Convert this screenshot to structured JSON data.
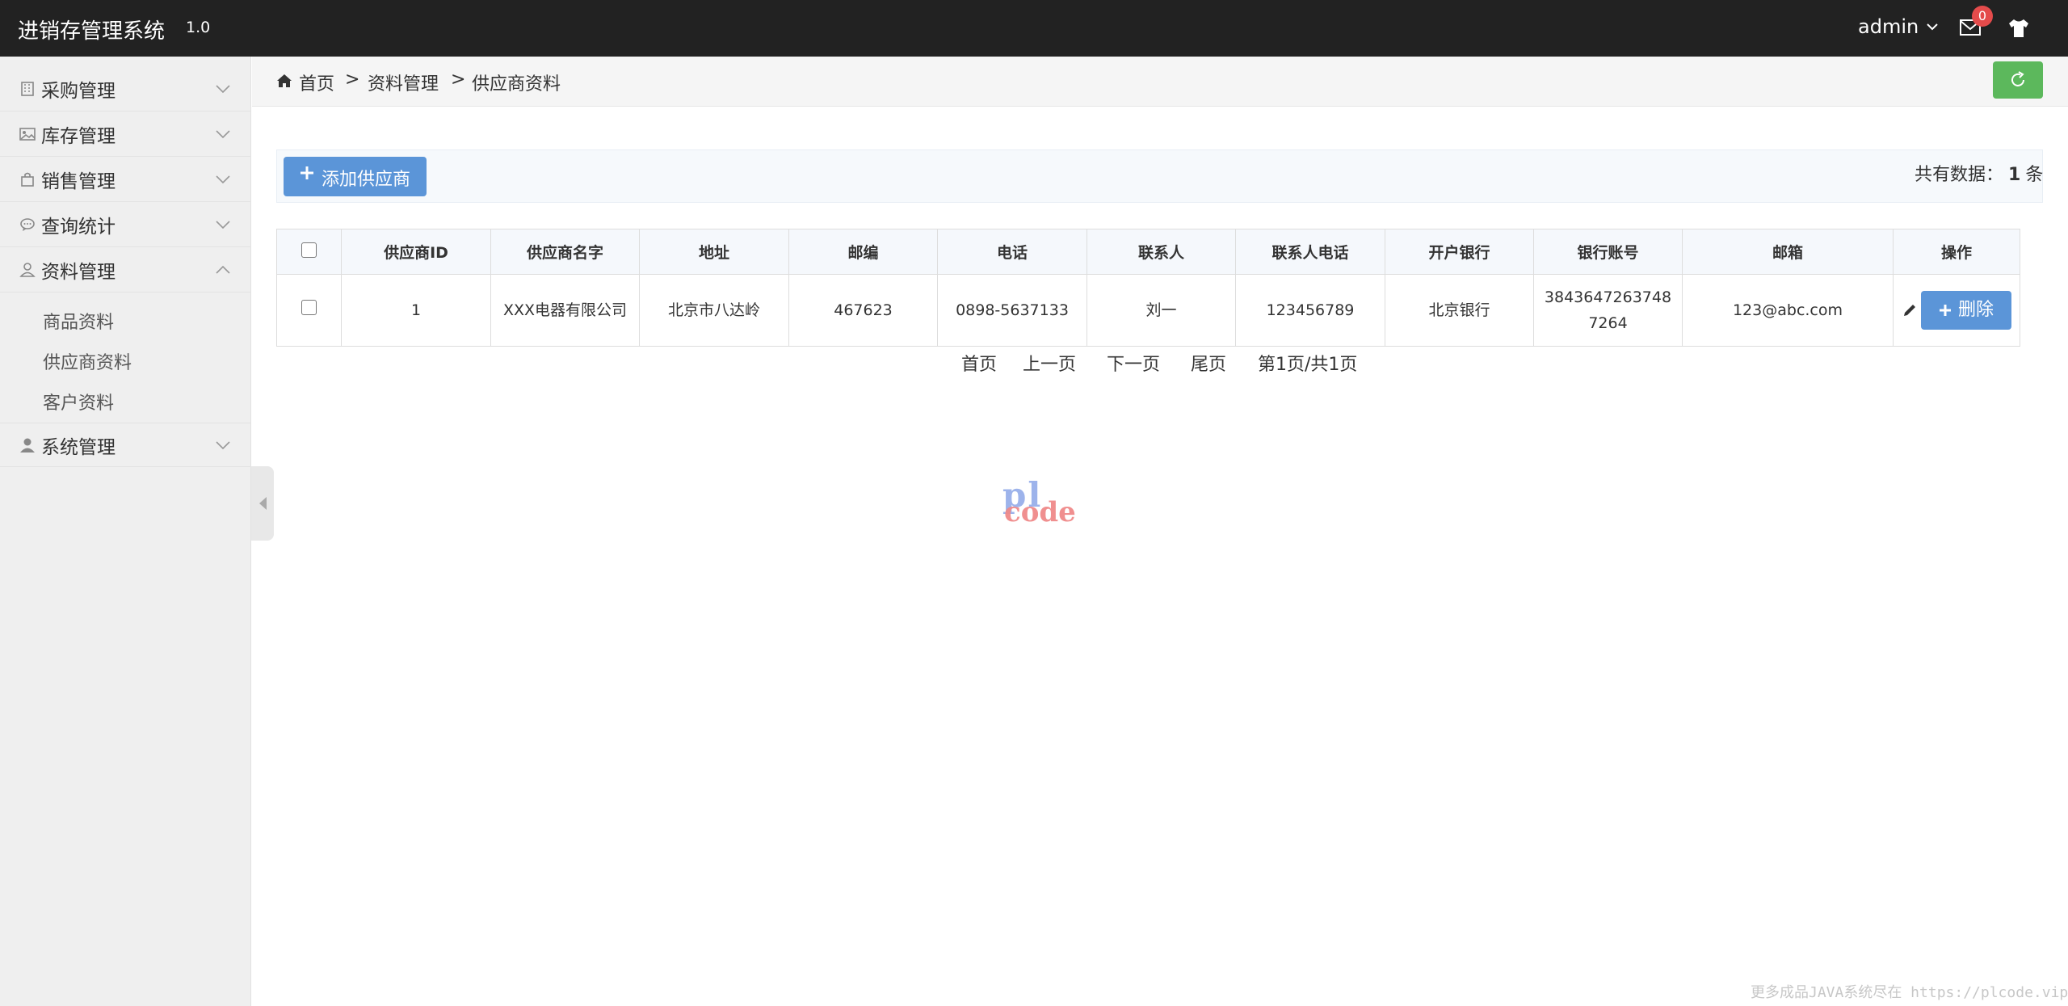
{
  "header": {
    "brand": "进销存管理系统",
    "version": "1.0",
    "user": "admin",
    "mail_count": "0"
  },
  "sidebar": {
    "items": [
      {
        "label": "采购管理",
        "icon": "building-icon"
      },
      {
        "label": "库存管理",
        "icon": "image-icon"
      },
      {
        "label": "销售管理",
        "icon": "shopping-bag-icon"
      },
      {
        "label": "查询统计",
        "icon": "comment-icon"
      },
      {
        "label": "资料管理",
        "icon": "user-outline-icon"
      },
      {
        "label": "系统管理",
        "icon": "user-icon"
      }
    ],
    "sub_items": [
      "商品资料",
      "供应商资料",
      "客户资料"
    ]
  },
  "breadcrumb": {
    "home": "首页",
    "sep": ">",
    "level2": "资料管理",
    "current": "供应商资料"
  },
  "toolbar": {
    "add_label": "添加供应商",
    "total_prefix": "共有数据：",
    "total_count": "1",
    "total_suffix": "条"
  },
  "table": {
    "columns": [
      "供应商ID",
      "供应商名字",
      "地址",
      "邮编",
      "电话",
      "联系人",
      "联系人电话",
      "开户银行",
      "银行账号",
      "邮箱",
      "操作"
    ],
    "rows": [
      {
        "id": "1",
        "name": "XXX电器有限公司",
        "address": "北京市八达岭",
        "zip": "467623",
        "phone": "0898-5637133",
        "contact": "刘一",
        "contact_phone": "123456789",
        "bank": "北京银行",
        "account": "38436472637487264",
        "email": "123@abc.com",
        "delete_label": "删除"
      }
    ]
  },
  "pager": {
    "first": "首页",
    "prev": "上一页",
    "next": "下一页",
    "last": "尾页",
    "status": "第1页/共1页"
  },
  "watermark": {
    "logo_top": "pl",
    "logo_bottom": "code",
    "footer": "更多成品JAVA系统尽在 https://plcode.vip"
  },
  "colors": {
    "header_bg": "#222222",
    "sidebar_bg": "#efefef",
    "primary": "#5b95d8",
    "success": "#5cb85c",
    "badge": "#e44b4b"
  }
}
